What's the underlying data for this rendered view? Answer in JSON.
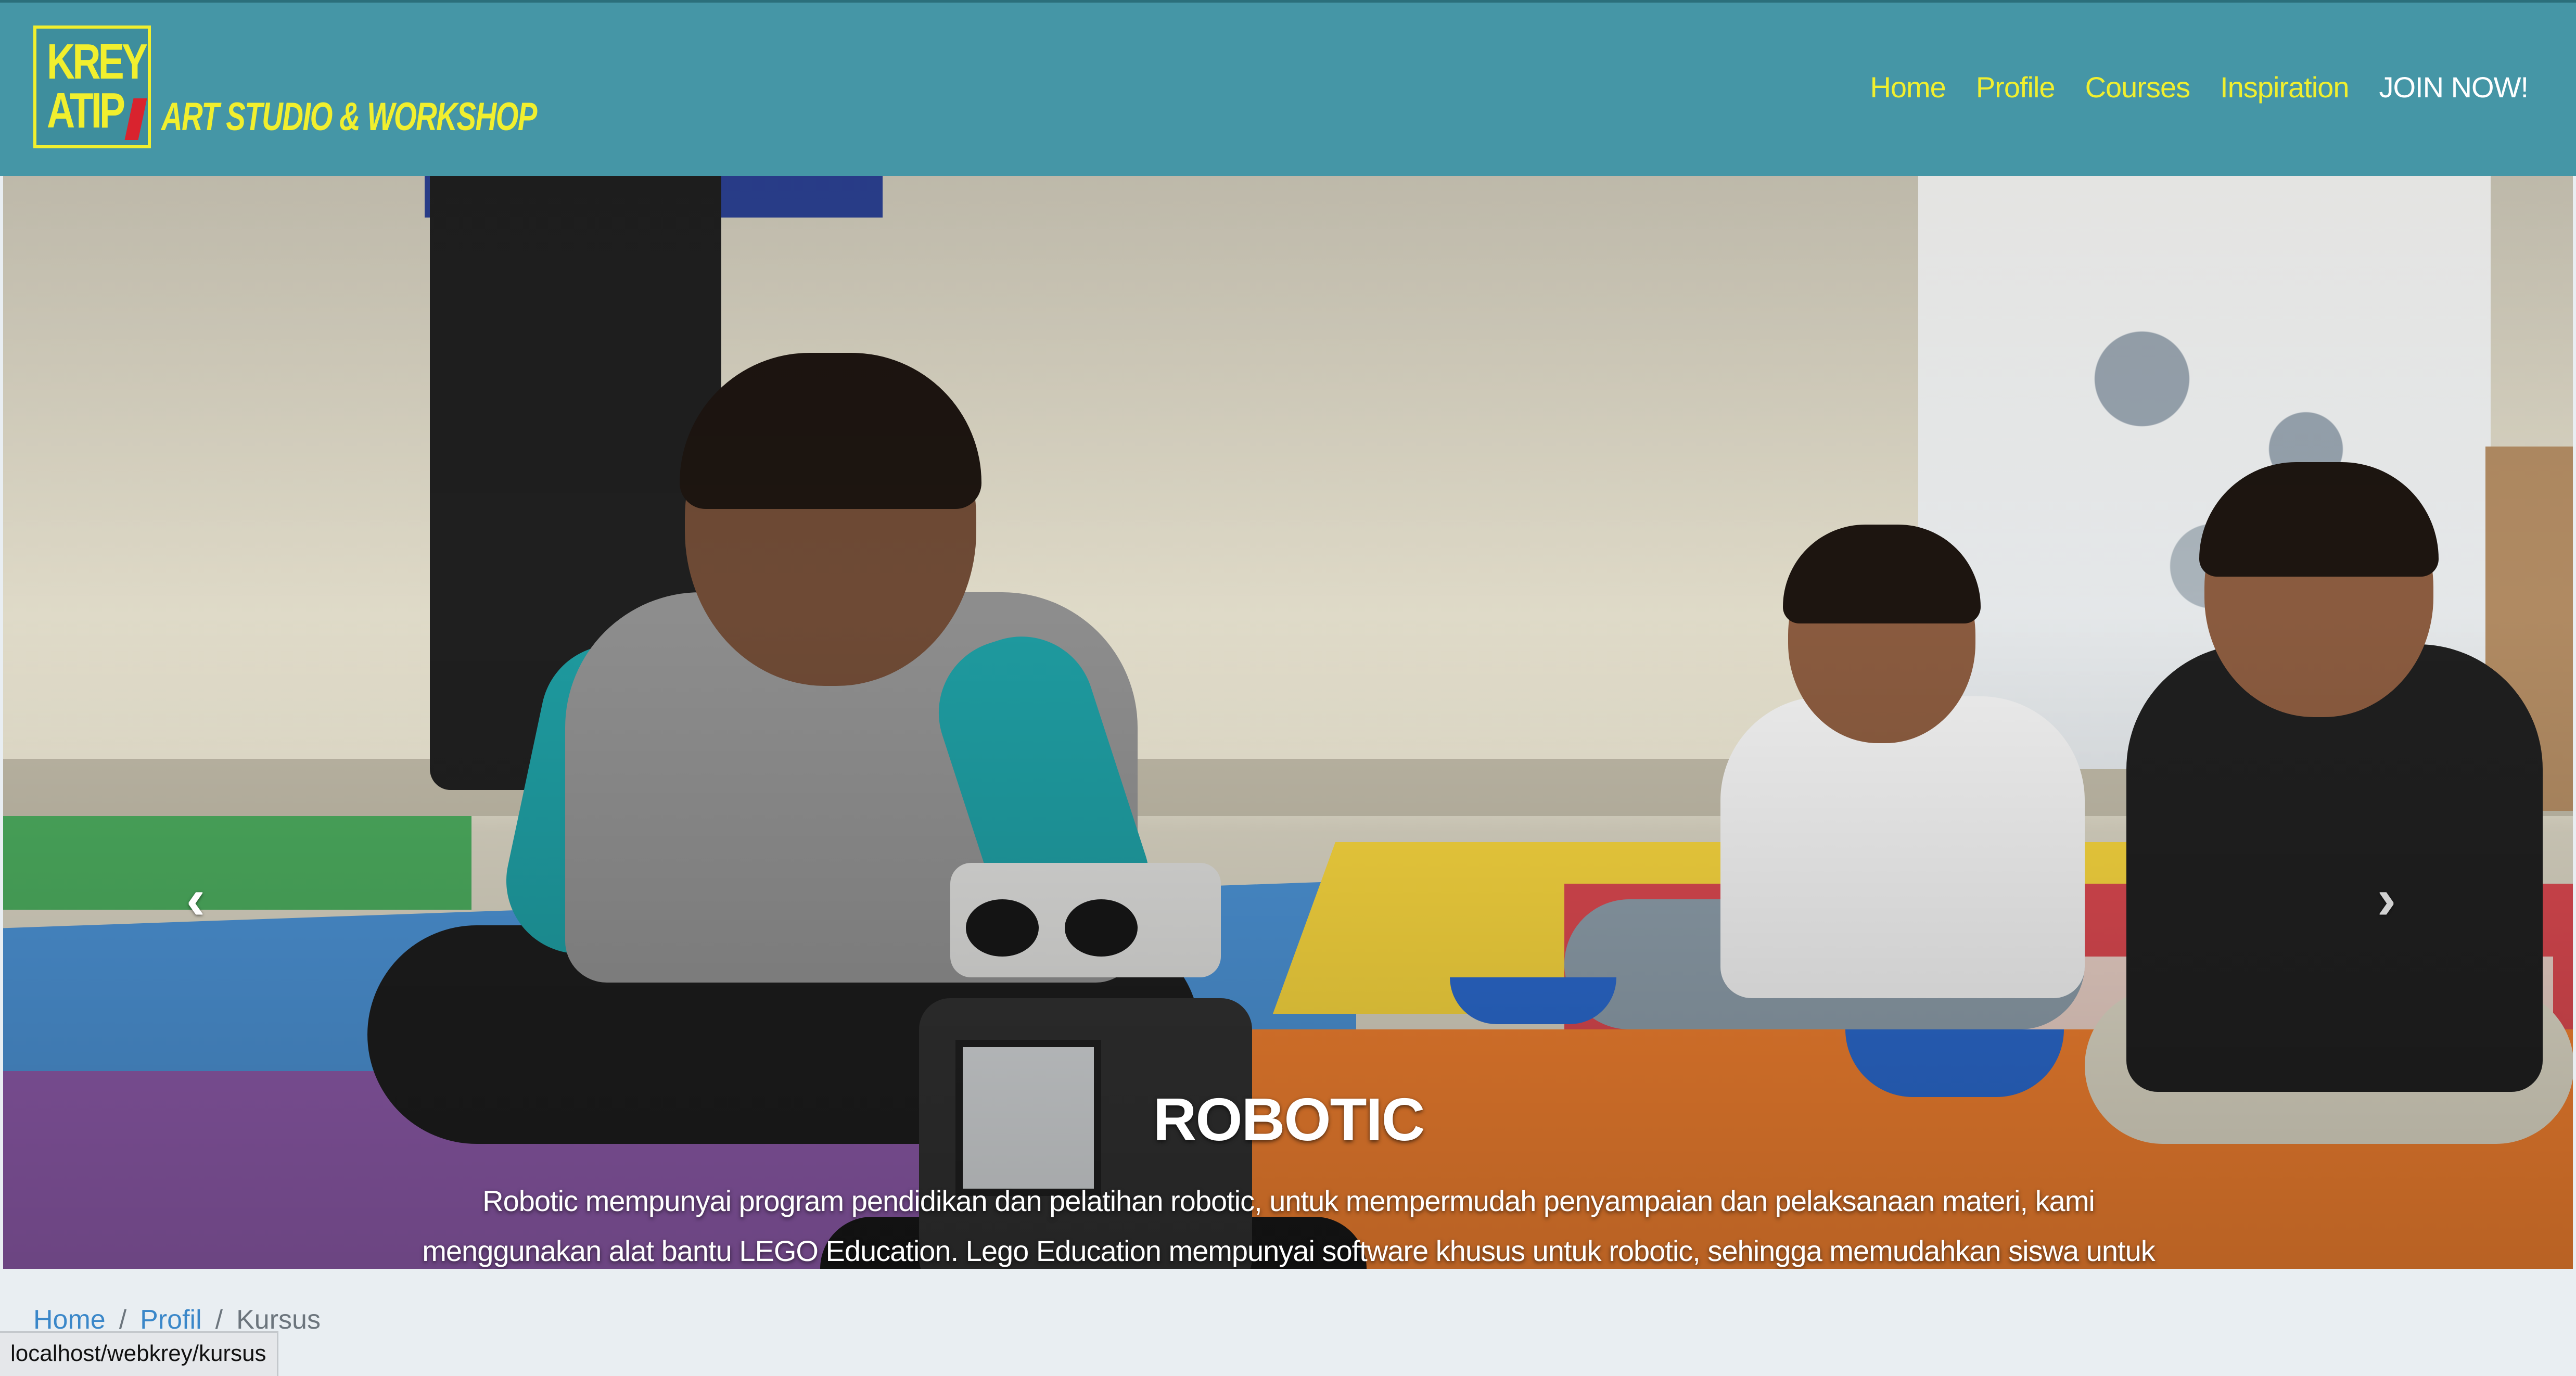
{
  "brand": {
    "logo_line1": "KREY",
    "logo_line2": "ATIP",
    "tagline": "ART STUDIO & WORKSHOP"
  },
  "nav": {
    "items": [
      {
        "label": "Home"
      },
      {
        "label": "Profile"
      },
      {
        "label": "Courses"
      },
      {
        "label": "Inspiration"
      },
      {
        "label": "JOIN NOW!"
      }
    ]
  },
  "carousel": {
    "prev_icon": "chevron-left-icon",
    "next_icon": "chevron-right-icon",
    "prev_glyph": "‹",
    "next_glyph": "›",
    "caption_title": "ROBOTIC",
    "caption_text": "Robotic mempunyai program pendidikan dan pelatihan robotic, untuk mempermudah penyampaian dan pelaksanaan materi, kami menggunakan alat bantu LEGO Education. Lego Education mempunyai software khusus untuk robotic, sehingga memudahkan siswa untuk membuat program dan mentransfernya ke robot untuk dijalankan.",
    "slide_count": 4,
    "active_slide": 1
  },
  "breadcrumb": {
    "items": [
      "Home",
      "Profil",
      "Kursus"
    ],
    "separator": "/"
  },
  "status_bar": {
    "url": "localhost/webkrey/kursus"
  },
  "colors": {
    "navbar": "#4596a6",
    "nav_link": "#f1ef2e",
    "join_link": "#ffffff",
    "breadcrumb_link": "#3a87c9"
  }
}
